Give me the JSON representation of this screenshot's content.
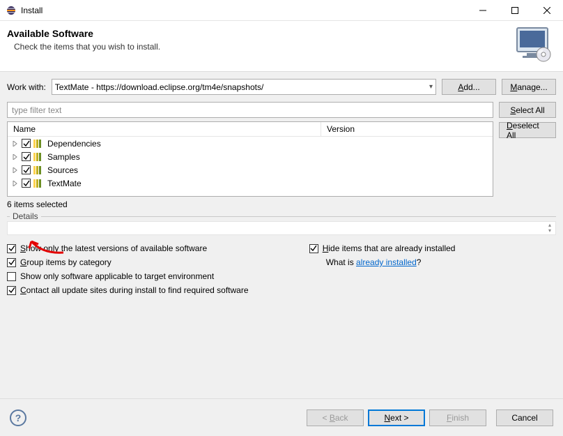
{
  "window": {
    "title": "Install"
  },
  "header": {
    "title": "Available Software",
    "subtitle": "Check the items that you wish to install."
  },
  "workwith": {
    "label": "Work with:",
    "value": "TextMate - https://download.eclipse.org/tm4e/snapshots/",
    "add_btn": "Add...",
    "manage_btn": "Manage..."
  },
  "filter": {
    "placeholder": "type filter text"
  },
  "sidebuttons": {
    "select_all": "Select All",
    "deselect_all": "Deselect All"
  },
  "columns": {
    "name": "Name",
    "version": "Version"
  },
  "items": [
    {
      "label": "Dependencies",
      "checked": true
    },
    {
      "label": "Samples",
      "checked": true
    },
    {
      "label": "Sources",
      "checked": true
    },
    {
      "label": "TextMate",
      "checked": true
    }
  ],
  "selection_text": "6 items selected",
  "details": {
    "legend": "Details"
  },
  "options": {
    "latest": "how only the latest versions of available software",
    "latest_mn": "S",
    "group": "roup items by category",
    "group_mn": "G",
    "target": "Show only software applicable to target environment",
    "contact": "ontact all update sites during install to find required software",
    "contact_mn": "C",
    "hide": "ide items that are already installed",
    "hide_mn": "H",
    "whatis_pre": "What is ",
    "whatis_link": "already installed",
    "whatis_post": "?"
  },
  "bottom": {
    "back": "< Back",
    "next": "Next >",
    "finish": "Finish",
    "cancel": "Cancel"
  }
}
